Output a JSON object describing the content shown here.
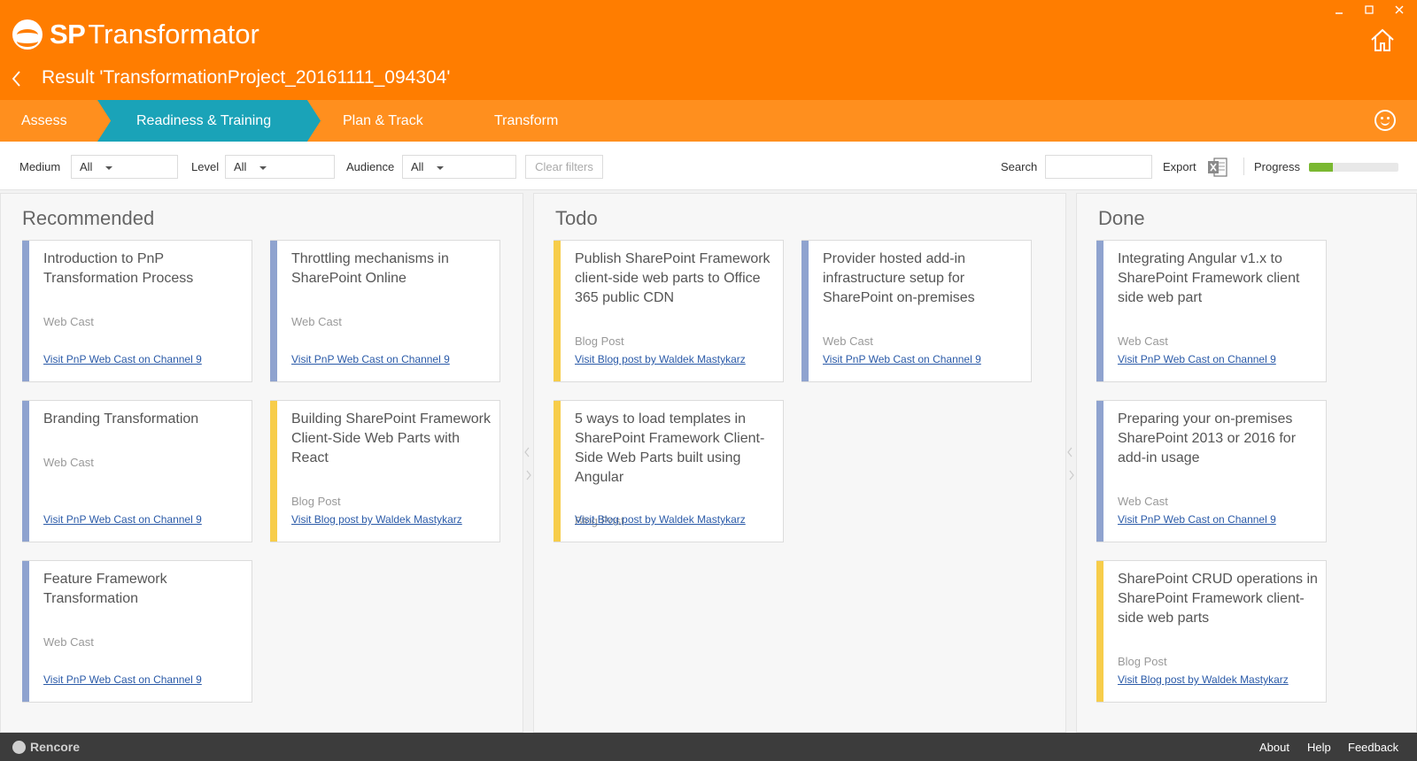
{
  "app": {
    "logo_sp": "SP",
    "logo_rest": "Transformator",
    "result_title": "Result 'TransformationProject_20161111_094304'"
  },
  "tabs": [
    {
      "label": "Assess"
    },
    {
      "label": "Readiness & Training",
      "active": true
    },
    {
      "label": "Plan & Track"
    },
    {
      "label": "Transform"
    }
  ],
  "filters": {
    "medium_label": "Medium",
    "medium_value": "All",
    "level_label": "Level",
    "level_value": "All",
    "audience_label": "Audience",
    "audience_value": "All",
    "clear_label": "Clear filters",
    "search_label": "Search",
    "search_value": "",
    "export_label": "Export",
    "progress_label": "Progress",
    "progress_fraction": 0.27
  },
  "colors": {
    "accent": "#ff7d00",
    "active_tab": "#1aa3b8",
    "webcast_stripe": "#8fa3cf",
    "blogpost_stripe": "#f7cd4a",
    "progress": "#7ab831"
  },
  "columns": [
    {
      "title": "Recommended",
      "cards": [
        {
          "title": "Introduction to PnP Transformation Process",
          "type": "Web Cast",
          "link": "Visit PnP Web Cast on Channel 9"
        },
        {
          "title": "Throttling mechanisms in SharePoint Online",
          "type": "Web Cast",
          "link": "Visit PnP Web Cast on Channel 9"
        },
        {
          "title": "Branding Transformation",
          "type": "Web Cast",
          "link": "Visit PnP Web Cast on Channel 9"
        },
        {
          "title": "Building SharePoint Framework Client-Side Web Parts with React",
          "type": "Blog Post",
          "link": "Visit Blog post by Waldek Mastykarz"
        },
        {
          "title": "Feature Framework Transformation",
          "type": "Web Cast",
          "link": "Visit PnP Web Cast on Channel 9"
        }
      ]
    },
    {
      "title": "Todo",
      "cards": [
        {
          "title": "Publish SharePoint Framework client-side web parts to Office 365 public CDN",
          "type": "Blog Post",
          "link": "Visit Blog post by Waldek Mastykarz"
        },
        {
          "title": "Provider hosted add-in infrastructure setup for SharePoint on-premises",
          "type": "Web Cast",
          "link": "Visit PnP Web Cast on Channel 9"
        },
        {
          "title": "5 ways to load templates in SharePoint Framework Client-Side Web Parts built using Angular",
          "type": "Blog Post",
          "link": "Visit Blog post by Waldek Mastykarz"
        }
      ]
    },
    {
      "title": "Done",
      "cards": [
        {
          "title": "Integrating Angular v1.x to SharePoint Framework client side web part",
          "type": "Web Cast",
          "link": "Visit PnP Web Cast on Channel 9"
        },
        {
          "title": "Preparing your on-premises SharePoint 2013 or 2016 for add-in usage",
          "type": "Web Cast",
          "link": "Visit PnP Web Cast on Channel 9"
        },
        {
          "title": "SharePoint CRUD operations in SharePoint Framework client-side web parts",
          "type": "Blog Post",
          "link": "Visit Blog post by Waldek Mastykarz"
        }
      ]
    }
  ],
  "footer": {
    "brand": "Rencore",
    "about": "About",
    "help": "Help",
    "feedback": "Feedback"
  }
}
